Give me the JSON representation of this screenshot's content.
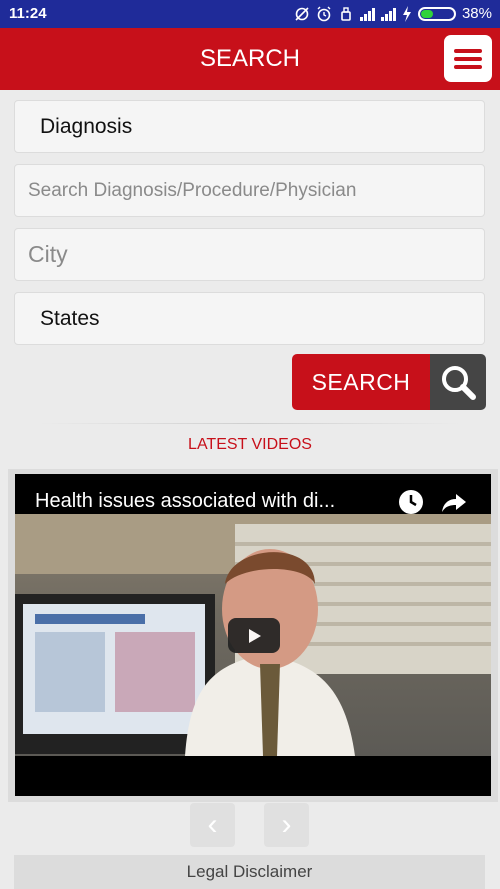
{
  "status_bar": {
    "time": "11:24",
    "battery_percent": "38%",
    "battery_level": 0.38,
    "icons": [
      "sync-off-icon",
      "alarm-icon",
      "usb-icon",
      "signal-icon",
      "signal-icon",
      "charging-icon",
      "battery-icon"
    ]
  },
  "header": {
    "title": "SEARCH",
    "menu_icon": "hamburger-menu-icon"
  },
  "form": {
    "category_value": "Diagnosis",
    "query_placeholder": "Search Diagnosis/Procedure/Physician",
    "city_placeholder": "City",
    "states_value": "States",
    "search_button_label": "SEARCH",
    "search_icon": "magnifier-icon"
  },
  "videos": {
    "section_title": "LATEST VIDEOS",
    "current_title": "Health issues associated with di...",
    "prev_label": "‹",
    "next_label": "›"
  },
  "footer": {
    "legal_label": "Legal Disclaimer"
  },
  "colors": {
    "brand_red": "#c7101a",
    "status_bar": "#1f2b99",
    "search_icon_bg": "#454545"
  }
}
